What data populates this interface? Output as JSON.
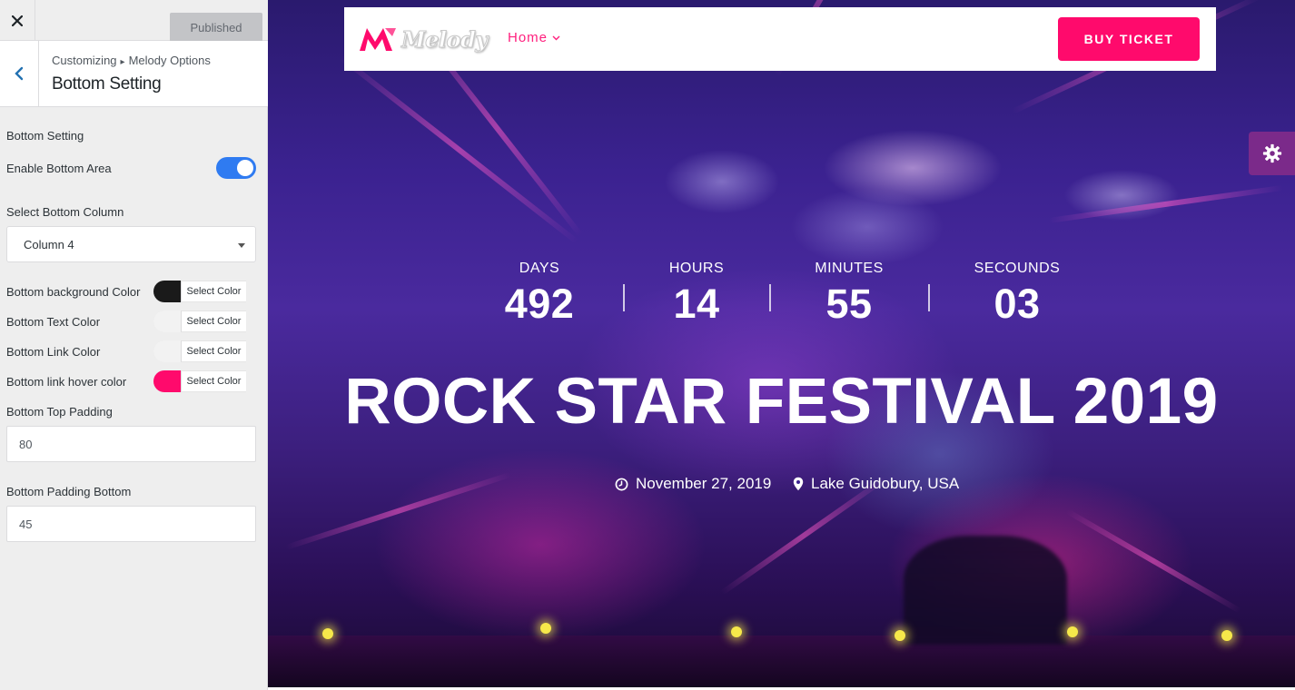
{
  "topbar": {
    "close_label": "×",
    "publish_label": "Published"
  },
  "section": {
    "breadcrumb_root": "Customizing",
    "breadcrumb_sep": "▸",
    "breadcrumb_parent": "Melody Options",
    "title": "Bottom Setting"
  },
  "controls": {
    "group_heading": "Bottom Setting",
    "enable_label": "Enable Bottom Area",
    "enable_on": true,
    "column_label": "Select Bottom Column",
    "column_value": "Column 4",
    "bg_color_label": "Bottom background Color",
    "bg_color": "#1a1a1a",
    "text_color_label": "Bottom Text Color",
    "text_color": "#f2f2f2",
    "link_color_label": "Bottom Link Color",
    "link_color": "#f2f2f2",
    "hover_color_label": "Bottom link hover color",
    "hover_color": "#ff0a6c",
    "select_color_label": "Select Color",
    "top_padding_label": "Bottom Top Padding",
    "top_padding_value": "80",
    "bottom_padding_label": "Bottom Padding Bottom",
    "bottom_padding_value": "45"
  },
  "site": {
    "logo_text": "Melody",
    "nav_home": "Home",
    "buy_label": "BUY TICKET",
    "accent_color": "#ff0a6c"
  },
  "countdown": [
    {
      "label": "DAYS",
      "value": "492"
    },
    {
      "label": "HOURS",
      "value": "14"
    },
    {
      "label": "MINUTES",
      "value": "55"
    },
    {
      "label": "SECOUNDS",
      "value": "03"
    }
  ],
  "hero": {
    "title": "ROCK STAR FESTIVAL 2019",
    "date": "November 27, 2019",
    "location": "Lake Guidobury, USA"
  }
}
